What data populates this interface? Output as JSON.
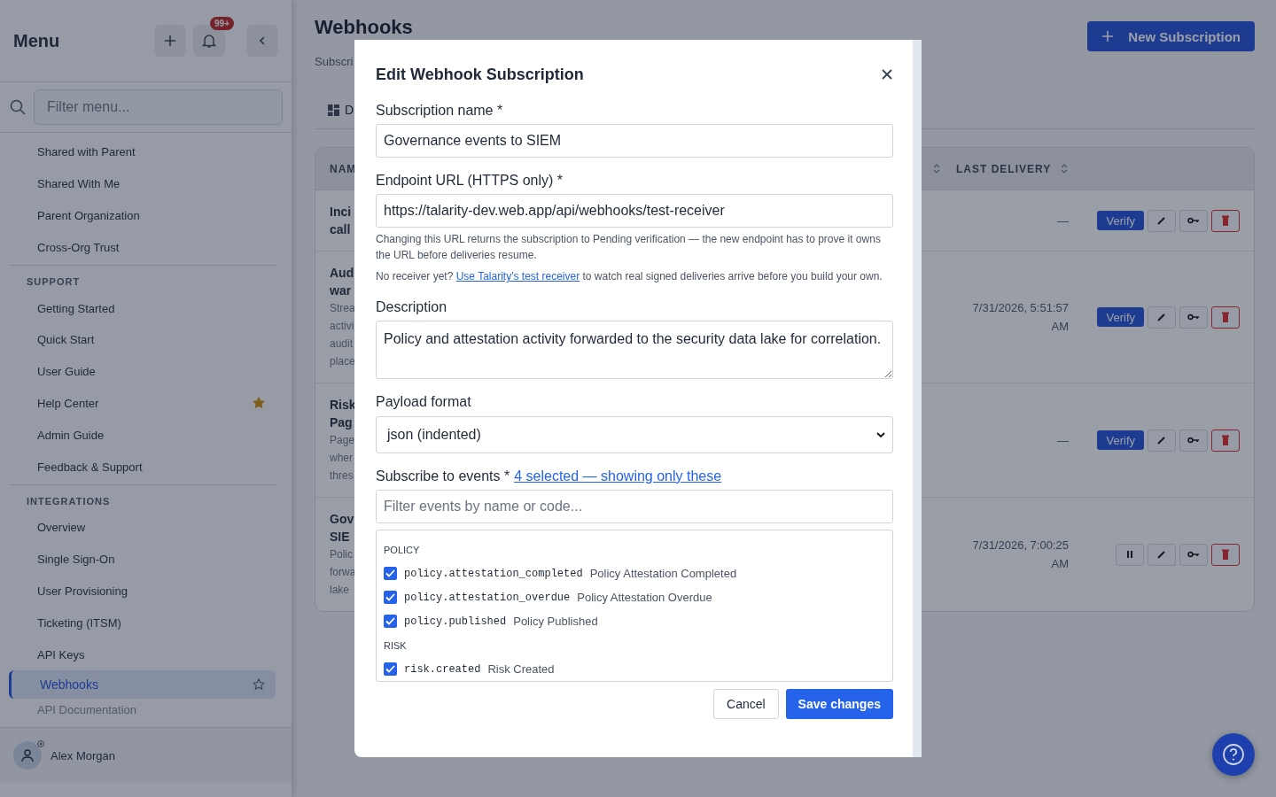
{
  "sidebar": {
    "title": "Menu",
    "notification_count": "99+",
    "filter": {
      "placeholder": "Filter menu..."
    },
    "sections": [
      {
        "items": [
          {
            "label": "Shared with Parent",
            "selected": false,
            "favorite": false
          },
          {
            "label": "Shared With Me",
            "selected": false,
            "favorite": false
          },
          {
            "label": "Parent Organization",
            "selected": false,
            "favorite": false
          },
          {
            "label": "Cross-Org Trust",
            "selected": false,
            "favorite": false
          }
        ]
      },
      {
        "heading": "SUPPORT",
        "items": [
          {
            "label": "Getting Started",
            "selected": false,
            "favorite": false
          },
          {
            "label": "Quick Start",
            "selected": false,
            "favorite": false
          },
          {
            "label": "User Guide",
            "selected": false,
            "favorite": false
          },
          {
            "label": "Help Center",
            "selected": false,
            "favorite": true
          },
          {
            "label": "Admin Guide",
            "selected": false,
            "favorite": false
          },
          {
            "label": "Feedback & Support",
            "selected": false,
            "favorite": false
          }
        ]
      },
      {
        "heading": "INTEGRATIONS",
        "items": [
          {
            "label": "Overview",
            "selected": false,
            "favorite": false
          },
          {
            "label": "Single Sign-On",
            "selected": false,
            "favorite": false
          },
          {
            "label": "User Provisioning",
            "selected": false,
            "favorite": false
          },
          {
            "label": "Ticketing (ITSM)",
            "selected": false,
            "favorite": false
          },
          {
            "label": "API Keys",
            "selected": false,
            "favorite": false
          },
          {
            "label": "Webhooks",
            "selected": true,
            "favorite": false
          },
          {
            "label": "API Documentation",
            "selected": false,
            "favorite": false
          }
        ]
      }
    ],
    "user": {
      "name": "Alex Morgan"
    }
  },
  "page": {
    "title": "Webhooks",
    "subtitle": "Subscri",
    "new_button": "New Subscription",
    "tab": "D"
  },
  "table": {
    "columns": [
      {
        "label": "NAM"
      },
      {
        "label": "LAST DELIVERY"
      }
    ],
    "rows": [
      {
        "name_lines": [
          "Inci",
          "call"
        ],
        "description_lines": [],
        "last_delivery": "—",
        "actions": [
          {
            "kind": "verify",
            "label": "Verify"
          },
          {
            "kind": "edit"
          },
          {
            "kind": "key"
          },
          {
            "kind": "delete"
          }
        ]
      },
      {
        "name_lines": [
          "Aud",
          "war"
        ],
        "description_lines": [
          "Strea",
          "activi",
          "audit",
          "place"
        ],
        "last_delivery": "7/31/2026, 5:51:57 AM",
        "actions": [
          {
            "kind": "verify",
            "label": "Verify"
          },
          {
            "kind": "edit"
          },
          {
            "kind": "key"
          },
          {
            "kind": "delete"
          }
        ]
      },
      {
        "name_lines": [
          "Risk",
          "Pag"
        ],
        "description_lines": [
          "Page",
          "wher",
          "thres"
        ],
        "last_delivery": "—",
        "actions": [
          {
            "kind": "verify",
            "label": "Verify"
          },
          {
            "kind": "edit"
          },
          {
            "kind": "key"
          },
          {
            "kind": "delete"
          }
        ]
      },
      {
        "name_lines": [
          "Gov",
          "SIE"
        ],
        "description_lines": [
          "Polic",
          "forwa",
          "lake"
        ],
        "last_delivery": "7/31/2026, 7:00:25 AM",
        "actions": [
          {
            "kind": "pause"
          },
          {
            "kind": "edit"
          },
          {
            "kind": "key"
          },
          {
            "kind": "delete"
          }
        ]
      }
    ]
  },
  "modal": {
    "title": "Edit Webhook Subscription",
    "name_label": "Subscription name *",
    "name_value": "Governance events to SIEM",
    "url_label": "Endpoint URL (HTTPS only) *",
    "url_value": "https://talarity-dev.web.app/api/webhooks/test-receiver",
    "url_help": "Changing this URL returns the subscription to Pending verification — the new endpoint has to prove it owns the URL before deliveries resume.",
    "receiver_help_before": "No receiver yet?",
    "receiver_link": "Use Talarity's test receiver",
    "receiver_help_after": "to watch real signed deliveries arrive before you build your own.",
    "description_label": "Description",
    "description_value": "Policy and attestation activity forwarded to the security data lake for correlation.",
    "format_label": "Payload format",
    "format_value": "json (indented)",
    "events_label": "Subscribe to events *",
    "events_link": "4 selected — showing only these",
    "events_filter": {
      "placeholder": "Filter events by name or code..."
    },
    "event_groups": [
      {
        "name": "POLICY",
        "events": [
          {
            "code": "policy.attestation_completed",
            "label": "Policy Attestation Completed",
            "checked": true
          },
          {
            "code": "policy.attestation_overdue",
            "label": "Policy Attestation Overdue",
            "checked": true
          },
          {
            "code": "policy.published",
            "label": "Policy Published",
            "checked": true
          }
        ]
      },
      {
        "name": "RISK",
        "events": [
          {
            "code": "risk.created",
            "label": "Risk Created",
            "checked": true
          }
        ]
      }
    ],
    "cancel": "Cancel",
    "save": "Save changes"
  }
}
